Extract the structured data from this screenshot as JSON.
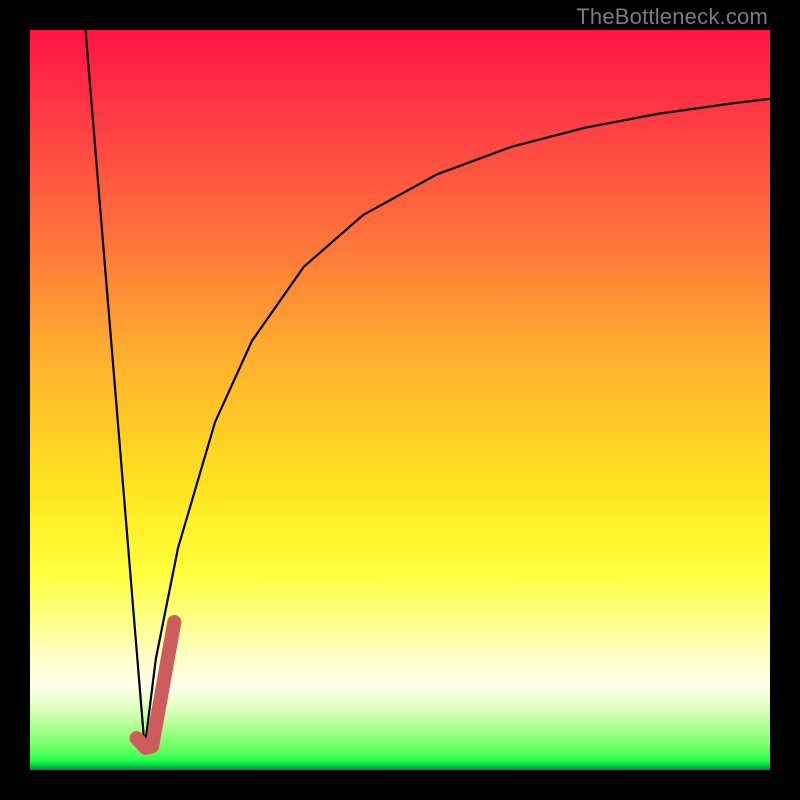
{
  "watermark": "TheBottleneck.com",
  "chart_data": {
    "type": "line",
    "title": "",
    "xlabel": "",
    "ylabel": "",
    "xlim": [
      0,
      100
    ],
    "ylim": [
      0,
      100
    ],
    "grid": false,
    "series": [
      {
        "name": "left-descent",
        "color": "#000000",
        "width": 2.2,
        "x": [
          7.5,
          15.5
        ],
        "y": [
          100,
          3
        ]
      },
      {
        "name": "right-ascent-curve",
        "color": "#000000",
        "width": 2.2,
        "x": [
          15.5,
          17,
          20,
          25,
          30,
          37,
          45,
          55,
          65,
          75,
          85,
          95,
          100
        ],
        "y": [
          3,
          15,
          30,
          47,
          58,
          68,
          75,
          80.5,
          84.2,
          86.8,
          88.7,
          90.1,
          90.7
        ]
      },
      {
        "name": "overlay-j-stroke",
        "color": "#cf5c5c",
        "width": 14,
        "linecap": "round",
        "x": [
          14.4,
          15.6,
          16.5,
          19.5
        ],
        "y": [
          4.3,
          3.0,
          3.2,
          20
        ]
      }
    ]
  }
}
